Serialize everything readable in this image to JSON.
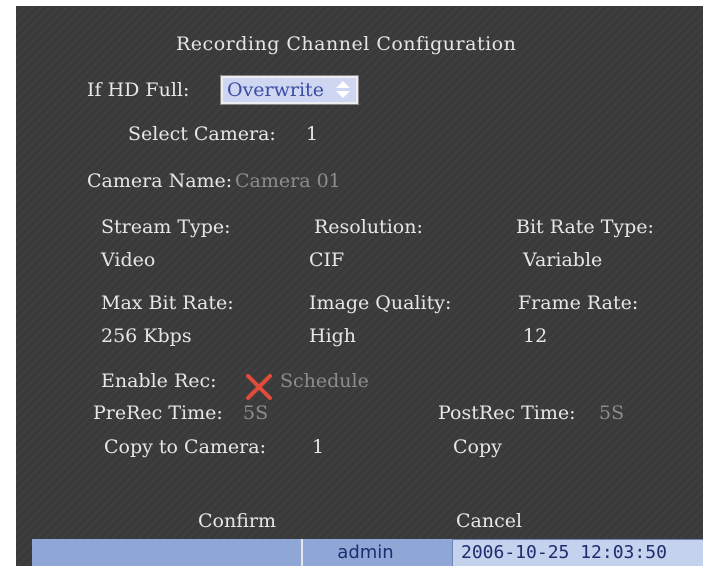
{
  "title": "Recording Channel Configuration",
  "if_hd_full": {
    "label": "If HD Full:",
    "value": "Overwrite"
  },
  "select_camera": {
    "label": "Select Camera:",
    "value": "1"
  },
  "camera_name": {
    "label": "Camera Name:",
    "value": "Camera 01"
  },
  "grid": {
    "row1": [
      {
        "label": "Stream Type:",
        "value": "Video"
      },
      {
        "label": "Resolution:",
        "value": "CIF"
      },
      {
        "label": "Bit Rate Type:",
        "value": "Variable"
      }
    ],
    "row2": [
      {
        "label": "Max Bit Rate:",
        "value": "256 Kbps"
      },
      {
        "label": "Image Quality:",
        "value": "High"
      },
      {
        "label": "Frame Rate:",
        "value": "12"
      }
    ]
  },
  "enable_rec": {
    "label": "Enable Rec:",
    "icon": "x-mark-icon",
    "icon_color": "#e34a3a",
    "schedule": "Schedule"
  },
  "prerec": {
    "label": "PreRec Time:",
    "value": "5S"
  },
  "postrec": {
    "label": "PostRec Time:",
    "value": "5S"
  },
  "copy_to_camera": {
    "label": "Copy to Camera:",
    "value": "1",
    "button": "Copy"
  },
  "footer": {
    "confirm": "Confirm",
    "cancel": "Cancel"
  },
  "status_bar": {
    "user": "admin",
    "datetime": "2006-10-25 12:03:50"
  }
}
